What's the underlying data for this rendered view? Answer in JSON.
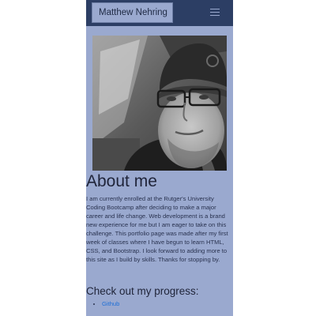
{
  "navbar": {
    "brand": "Matthew Nehring",
    "toggle_icon": "hamburger-icon"
  },
  "profile_photo": {
    "icon": "portrait-photo"
  },
  "about": {
    "title": "About me",
    "bio": "I am currently enrolled at the Rutger's University Coding Bootcamp after deciding to make a major career and life change. Web development is a brand new experience for me but I am eager to take on this challenge. This portfolio page was made after my first week of classes where I have begun to learn HTML, CSS, and Bootstrap. I look forward to adding more to this site as I build by skills. Thanks for stopping by."
  },
  "progress": {
    "title": "Check out my progress:",
    "links": [
      {
        "label": "Github"
      }
    ]
  },
  "colors": {
    "navbar_bg": "#2c3e64",
    "page_bg": "#9aa9cf",
    "link": "#1f6fd6"
  }
}
